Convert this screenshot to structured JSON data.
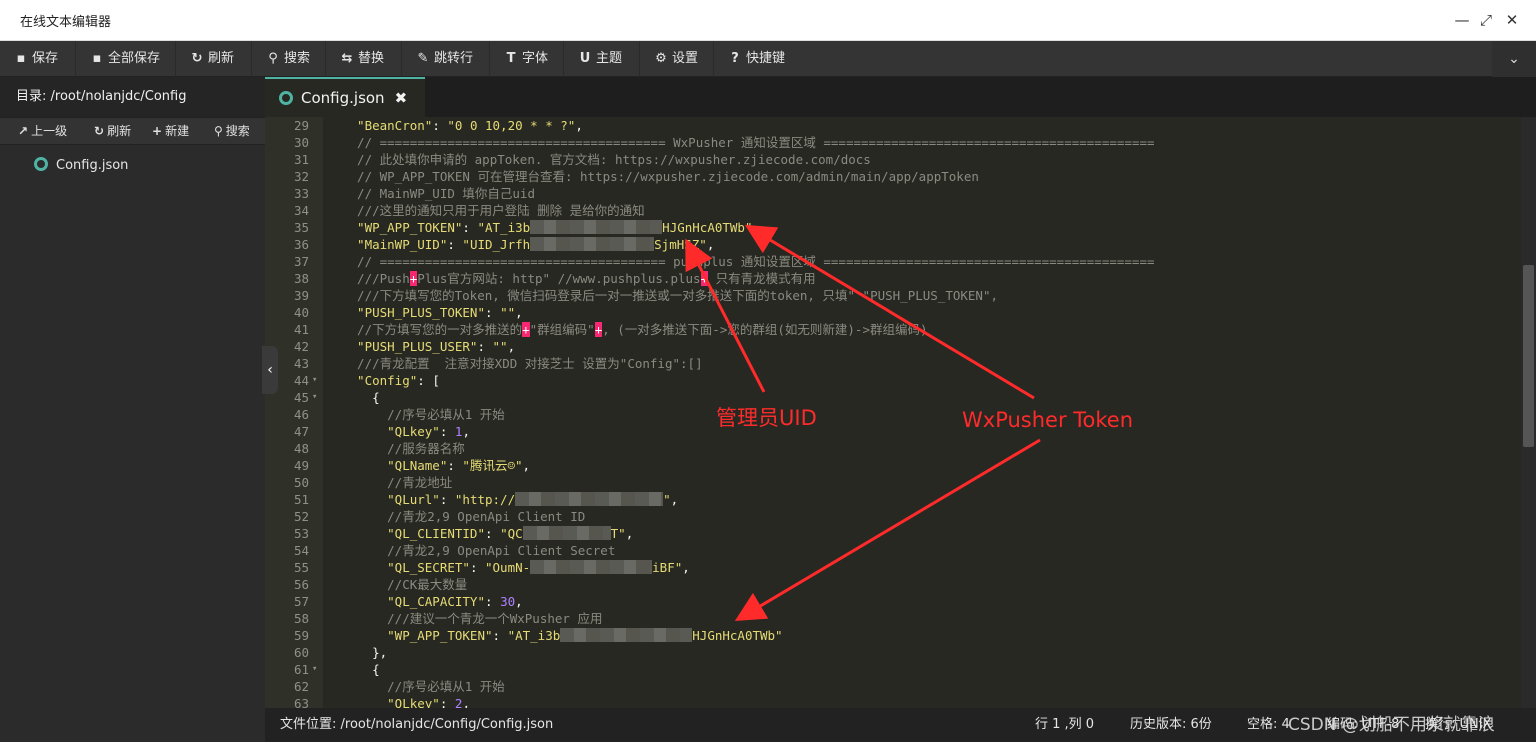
{
  "window": {
    "title": "在线文本编辑器"
  },
  "toolbar": {
    "buttons": [
      {
        "icon": "save-icon",
        "glyph": "▪",
        "label": "保存"
      },
      {
        "icon": "save-all-icon",
        "glyph": "▪",
        "label": "全部保存"
      },
      {
        "icon": "refresh-icon",
        "glyph": "↻",
        "label": "刷新"
      },
      {
        "icon": "search-icon",
        "glyph": "⚲",
        "label": "搜索"
      },
      {
        "icon": "replace-icon",
        "glyph": "⇆",
        "label": "替换"
      },
      {
        "icon": "pin-icon",
        "glyph": "✎",
        "label": "跳转行"
      },
      {
        "icon": "font-icon",
        "glyph": "T",
        "label": "字体"
      },
      {
        "icon": "theme-icon",
        "glyph": "U",
        "label": "主题"
      },
      {
        "icon": "gear-icon",
        "glyph": "⚙",
        "label": "设置"
      },
      {
        "icon": "help-icon",
        "glyph": "?",
        "label": "快捷键"
      }
    ]
  },
  "sidebar": {
    "directory_label": "目录: /root/nolanjdc/Config",
    "actions": [
      {
        "icon": "up-icon",
        "glyph": "↗",
        "label": "上一级"
      },
      {
        "icon": "refresh-icon",
        "glyph": "↻",
        "label": "刷新"
      },
      {
        "icon": "plus-icon",
        "glyph": "+",
        "label": "新建"
      },
      {
        "icon": "search-icon",
        "glyph": "⚲",
        "label": "搜索"
      }
    ],
    "files": [
      "Config.json"
    ]
  },
  "tabs": [
    {
      "label": "Config.json",
      "active": true
    }
  ],
  "editor": {
    "lines": [
      {
        "n": "29",
        "segs": [
          [
            "key",
            "  \"BeanCron\""
          ],
          [
            "pun",
            ": "
          ],
          [
            "str",
            "\"0 0 10,20 * * ?\""
          ],
          [
            "pun",
            ","
          ]
        ]
      },
      {
        "n": "30",
        "segs": [
          [
            "cm",
            "  // ====================================== WxPusher 通知设置区域 ============================================"
          ]
        ]
      },
      {
        "n": "31",
        "segs": [
          [
            "cm",
            "  // 此处填你申请的 appToken. 官方文档: https://wxpusher.zjiecode.com/docs"
          ]
        ]
      },
      {
        "n": "32",
        "segs": [
          [
            "cm",
            "  // WP_APP_TOKEN 可在管理台查看: https://wxpusher.zjiecode.com/admin/main/app/appToken"
          ]
        ]
      },
      {
        "n": "33",
        "segs": [
          [
            "cm",
            "  // MainWP_UID 填你自己uid"
          ]
        ]
      },
      {
        "n": "34",
        "segs": [
          [
            "cm",
            "  ///这里的通知只用于用户登陆 删除 是给你的通知"
          ]
        ]
      },
      {
        "n": "35",
        "segs": [
          [
            "key",
            "  \"WP_APP_TOKEN\""
          ],
          [
            "pun",
            ": "
          ],
          [
            "str",
            "\"AT_i3b"
          ],
          [
            "blur",
            "132"
          ],
          [
            "str",
            "HJGnHcA0TWb\""
          ],
          [
            "pun",
            ","
          ]
        ]
      },
      {
        "n": "36",
        "segs": [
          [
            "key",
            "  \"MainWP_UID\""
          ],
          [
            "pun",
            ": "
          ],
          [
            "str",
            "\"UID_Jrfh"
          ],
          [
            "blur",
            "124"
          ],
          [
            "str",
            "SjmHSZ\""
          ],
          [
            "pun",
            ","
          ]
        ]
      },
      {
        "n": "37",
        "segs": [
          [
            "cm",
            "  // ====================================== pushplus 通知设置区域 ============================================"
          ]
        ]
      },
      {
        "n": "38",
        "segs": [
          [
            "cm",
            "  ///Push"
          ],
          [
            "pink",
            "+"
          ],
          [
            "cm",
            "Plus官方网站: http\" //www.pushplus.plus"
          ],
          [
            "pink",
            "+"
          ],
          [
            "cm",
            " 只有青龙模式有用"
          ]
        ]
      },
      {
        "n": "39",
        "segs": [
          [
            "cm",
            "  ///下方填写您的Token, 微信扫码登录后一对一推送或一对多推送下面的token, 只填\" \"PUSH_PLUS_TOKEN\","
          ]
        ]
      },
      {
        "n": "40",
        "segs": [
          [
            "key",
            "  \"PUSH_PLUS_TOKEN\""
          ],
          [
            "pun",
            ": "
          ],
          [
            "str",
            "\"\""
          ],
          [
            "pun",
            ","
          ]
        ]
      },
      {
        "n": "41",
        "segs": [
          [
            "cm",
            "  //下方填写您的一对多推送的"
          ],
          [
            "pink",
            "+"
          ],
          [
            "cm",
            "\"群组编码\""
          ],
          [
            "pink",
            "+"
          ],
          [
            "cm",
            ", (一对多推送下面->您的群组(如无则新建)->群组编码)"
          ]
        ]
      },
      {
        "n": "42",
        "segs": [
          [
            "key",
            "  \"PUSH_PLUS_USER\""
          ],
          [
            "pun",
            ": "
          ],
          [
            "str",
            "\"\""
          ],
          [
            "pun",
            ","
          ]
        ]
      },
      {
        "n": "43",
        "segs": [
          [
            "cm",
            "  ///青龙配置  注意对接XDD 对接芝士 设置为\"Config\":[]"
          ]
        ]
      },
      {
        "n": "44",
        "fold": true,
        "segs": [
          [
            "key",
            "  \"Config\""
          ],
          [
            "pun",
            ": ["
          ]
        ]
      },
      {
        "n": "45",
        "fold": true,
        "segs": [
          [
            "pun",
            "    {"
          ]
        ]
      },
      {
        "n": "46",
        "segs": [
          [
            "cm",
            "      //序号必填从1 开始"
          ]
        ]
      },
      {
        "n": "47",
        "segs": [
          [
            "key",
            "      \"QLkey\""
          ],
          [
            "pun",
            ": "
          ],
          [
            "num",
            "1"
          ],
          [
            "pun",
            ","
          ]
        ]
      },
      {
        "n": "48",
        "segs": [
          [
            "cm",
            "      //服务器名称"
          ]
        ]
      },
      {
        "n": "49",
        "segs": [
          [
            "key",
            "      \"QLName\""
          ],
          [
            "pun",
            ": "
          ],
          [
            "str",
            "\"腾讯云☺\""
          ],
          [
            "pun",
            ","
          ]
        ]
      },
      {
        "n": "50",
        "segs": [
          [
            "cm",
            "      //青龙地址"
          ]
        ]
      },
      {
        "n": "51",
        "segs": [
          [
            "key",
            "      \"QLurl\""
          ],
          [
            "pun",
            ": "
          ],
          [
            "str",
            "\"http://"
          ],
          [
            "blur",
            "148"
          ],
          [
            "str",
            "\""
          ],
          [
            "pun",
            ","
          ]
        ]
      },
      {
        "n": "52",
        "segs": [
          [
            "cm",
            "      //青龙2,9 OpenApi Client ID"
          ]
        ]
      },
      {
        "n": "53",
        "segs": [
          [
            "key",
            "      \"QL_CLIENTID\""
          ],
          [
            "pun",
            ": "
          ],
          [
            "str",
            "\"QC"
          ],
          [
            "blur",
            "88"
          ],
          [
            "str",
            "T\""
          ],
          [
            "pun",
            ","
          ]
        ]
      },
      {
        "n": "54",
        "segs": [
          [
            "cm",
            "      //青龙2,9 OpenApi Client Secret"
          ]
        ]
      },
      {
        "n": "55",
        "segs": [
          [
            "key",
            "      \"QL_SECRET\""
          ],
          [
            "pun",
            ": "
          ],
          [
            "str",
            "\"OumN-"
          ],
          [
            "blur",
            "122"
          ],
          [
            "str",
            "iBF\""
          ],
          [
            "pun",
            ","
          ]
        ]
      },
      {
        "n": "56",
        "segs": [
          [
            "cm",
            "      //CK最大数量"
          ]
        ]
      },
      {
        "n": "57",
        "segs": [
          [
            "key",
            "      \"QL_CAPACITY\""
          ],
          [
            "pun",
            ": "
          ],
          [
            "num",
            "30"
          ],
          [
            "pun",
            ","
          ]
        ]
      },
      {
        "n": "58",
        "segs": [
          [
            "cm",
            "      ///建议一个青龙一个WxPusher 应用"
          ]
        ]
      },
      {
        "n": "59",
        "segs": [
          [
            "key",
            "      \"WP_APP_TOKEN\""
          ],
          [
            "pun",
            ": "
          ],
          [
            "str",
            "\"AT_i3b"
          ],
          [
            "blur",
            "132"
          ],
          [
            "str",
            "HJGnHcA0TWb\""
          ]
        ]
      },
      {
        "n": "60",
        "segs": [
          [
            "pun",
            "    },"
          ]
        ]
      },
      {
        "n": "61",
        "fold": true,
        "segs": [
          [
            "pun",
            "    {"
          ]
        ]
      },
      {
        "n": "62",
        "segs": [
          [
            "cm",
            "      //序号必填从1 开始"
          ]
        ]
      },
      {
        "n": "63",
        "segs": [
          [
            "key",
            "      \"QLkey\""
          ],
          [
            "pun",
            ": "
          ],
          [
            "num",
            "2"
          ],
          [
            "pun",
            ","
          ]
        ]
      }
    ]
  },
  "statusbar": {
    "file_location": "文件位置: /root/nolanjdc/Config/Config.json",
    "cursor": "行 1 ,列 0",
    "history": "历史版本: 6份",
    "indent": "空格: 4",
    "encoding": "编码: UTF-8",
    "lineend": "换行: UNIX"
  },
  "annotations": {
    "admin_uid": "管理员UID",
    "wxpusher_token": "WxPusher Token",
    "watermark": "CSDN @划船不用浆就靠浪"
  },
  "colors": {
    "accent": "#4fb3a4",
    "annotation": "#ff2b2b",
    "editor_bg": "#272822"
  }
}
